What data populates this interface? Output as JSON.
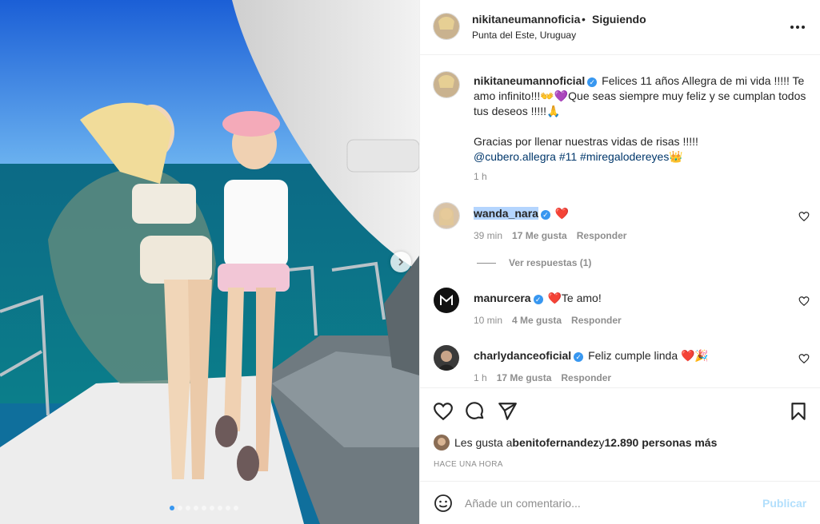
{
  "header": {
    "username": "nikitaneumannoficia",
    "separator": "•",
    "follow_status": "Siguiendo",
    "location": "Punta del Este, Uruguay",
    "more_icon": "more-horizontal-icon"
  },
  "caption": {
    "username": "nikitaneumannoficial",
    "verified_mark": "✓",
    "text_1": "Felices 11 años Allegra de mi vida !!!!! Te amo infinito!!!",
    "emoji_1": "👐💜",
    "text_2": "Que seas siempre muy feliz y se cumplan todos tus deseos !!!!!",
    "emoji_2": "🙏",
    "text_3": "Gracias por llenar nuestras vidas de risas !!!!!",
    "mention": "@cubero.allegra",
    "tag_1": "#11",
    "tag_2": "#miregalodereyes",
    "emoji_3": "👑",
    "time": "1 h"
  },
  "comments": [
    {
      "username": "wanda_nara",
      "verified": true,
      "text": "❤️",
      "time": "39 min",
      "likes": "17 Me gusta",
      "reply": "Responder"
    },
    {
      "username": "manurcera",
      "verified": true,
      "text": "❤️Te amo!",
      "time": "10 min",
      "likes": "4 Me gusta",
      "reply": "Responder"
    },
    {
      "username": "charlydanceoficial",
      "verified": true,
      "text": "Feliz cumple linda ❤️🎉",
      "time": "1 h",
      "likes": "17 Me gusta",
      "reply": "Responder"
    }
  ],
  "view_replies": "Ver respuestas (1)",
  "likes": {
    "prefix": "Les gusta a ",
    "user": "benitofernandez",
    "middle": " y ",
    "count": "12.890 personas más"
  },
  "time_ago": "HACE UNA HORA",
  "add_comment": {
    "placeholder": "Añade un comentario...",
    "publish": "Publicar"
  },
  "carousel": {
    "slides": 9,
    "current": 1
  },
  "colors": {
    "link": "#00376b",
    "accent": "#3897f0",
    "publish_disabled": "#b2dffc",
    "muted": "#8e8e8e"
  }
}
